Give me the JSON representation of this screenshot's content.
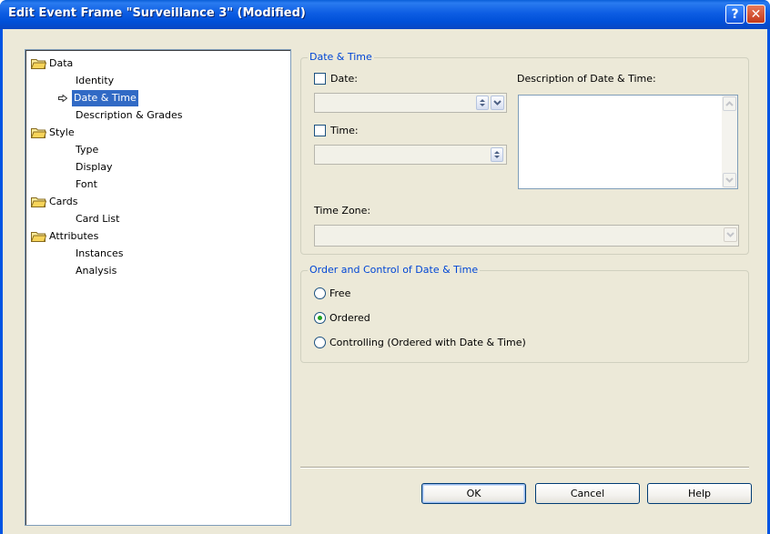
{
  "window": {
    "title": "Edit Event Frame \"Surveillance 3\" (Modified)",
    "help_glyph": "?",
    "close_glyph": "✕"
  },
  "tree": {
    "groups": [
      {
        "label": "Data",
        "icon": "folder-open-icon",
        "children": [
          "Identity",
          "Date & Time",
          "Description & Grades"
        ]
      },
      {
        "label": "Style",
        "icon": "folder-open-icon",
        "children": [
          "Type",
          "Display",
          "Font"
        ]
      },
      {
        "label": "Cards",
        "icon": "folder-open-icon",
        "children": [
          "Card List"
        ]
      },
      {
        "label": "Attributes",
        "icon": "folder-open-icon",
        "children": [
          "Instances",
          "Analysis"
        ]
      }
    ],
    "selected": "Date & Time",
    "selected_marker": "arrow-right-icon"
  },
  "datetime": {
    "group_title": "Date & Time",
    "date_label": "Date:",
    "date_checked": false,
    "date_value": "",
    "time_label": "Time:",
    "time_checked": false,
    "time_value": "",
    "description_label": "Description of Date & Time:",
    "description_value": "",
    "timezone_label": "Time Zone:",
    "timezone_value": ""
  },
  "order": {
    "group_title": "Order and Control of Date & Time",
    "options": [
      "Free",
      "Ordered",
      "Controlling (Ordered with Date & Time)"
    ],
    "selected": "Ordered"
  },
  "buttons": {
    "ok": "OK",
    "cancel": "Cancel",
    "help": "Help"
  },
  "colors": {
    "title_bar": "#0054e3",
    "dialog_bg": "#ece9d8",
    "group_title": "#0046d5",
    "selection": "#316ac5",
    "radio_dot": "#21a121"
  }
}
